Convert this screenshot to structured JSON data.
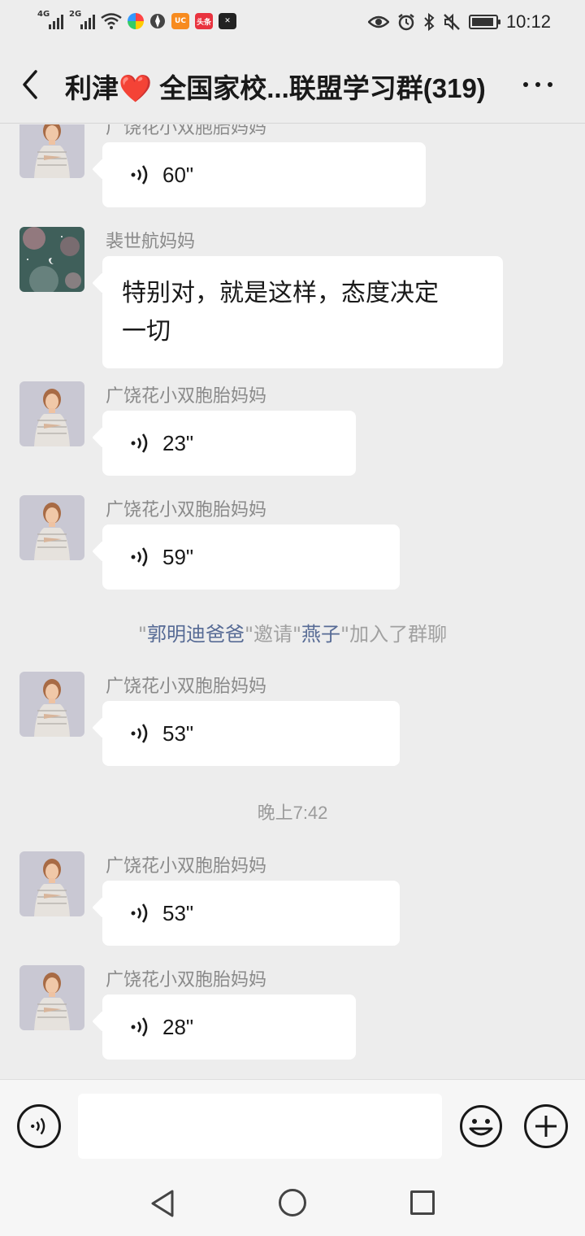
{
  "status_bar": {
    "signal1_label": "4G",
    "signal2_label": "2G",
    "app_badge_label": "头条",
    "time": "10:12",
    "battery_level": 0.8
  },
  "header": {
    "title": "利津❤️ 全国家校...联盟学习群(319)"
  },
  "messages": [
    {
      "sender": "广饶花小双胞胎妈妈",
      "type": "voice",
      "duration": "60\""
    },
    {
      "sender": "裴世航妈妈",
      "type": "text",
      "lines": [
        "特别对，就是这样，态度决定",
        "一切"
      ]
    },
    {
      "sender": "广饶花小双胞胎妈妈",
      "type": "voice",
      "duration": "23\""
    },
    {
      "sender": "广饶花小双胞胎妈妈",
      "type": "voice",
      "duration": "59\""
    },
    {
      "sender": "广饶花小双胞胎妈妈",
      "type": "voice",
      "duration": "53\""
    },
    {
      "sender": "广饶花小双胞胎妈妈",
      "type": "voice",
      "duration": "53\""
    },
    {
      "sender": "广饶花小双胞胎妈妈",
      "type": "voice",
      "duration": "28\""
    }
  ],
  "system_notice": {
    "q1": "\"",
    "inviter": "郭明迪爸爸",
    "q2": "\"邀请\"",
    "invitee": "燕子",
    "q3": "\"加入了群聊"
  },
  "timestamp": "晚上7:42",
  "input_bar": {
    "placeholder": ""
  },
  "colors": {
    "background": "#ededed",
    "bubble": "#ffffff",
    "link": "#576b95"
  }
}
